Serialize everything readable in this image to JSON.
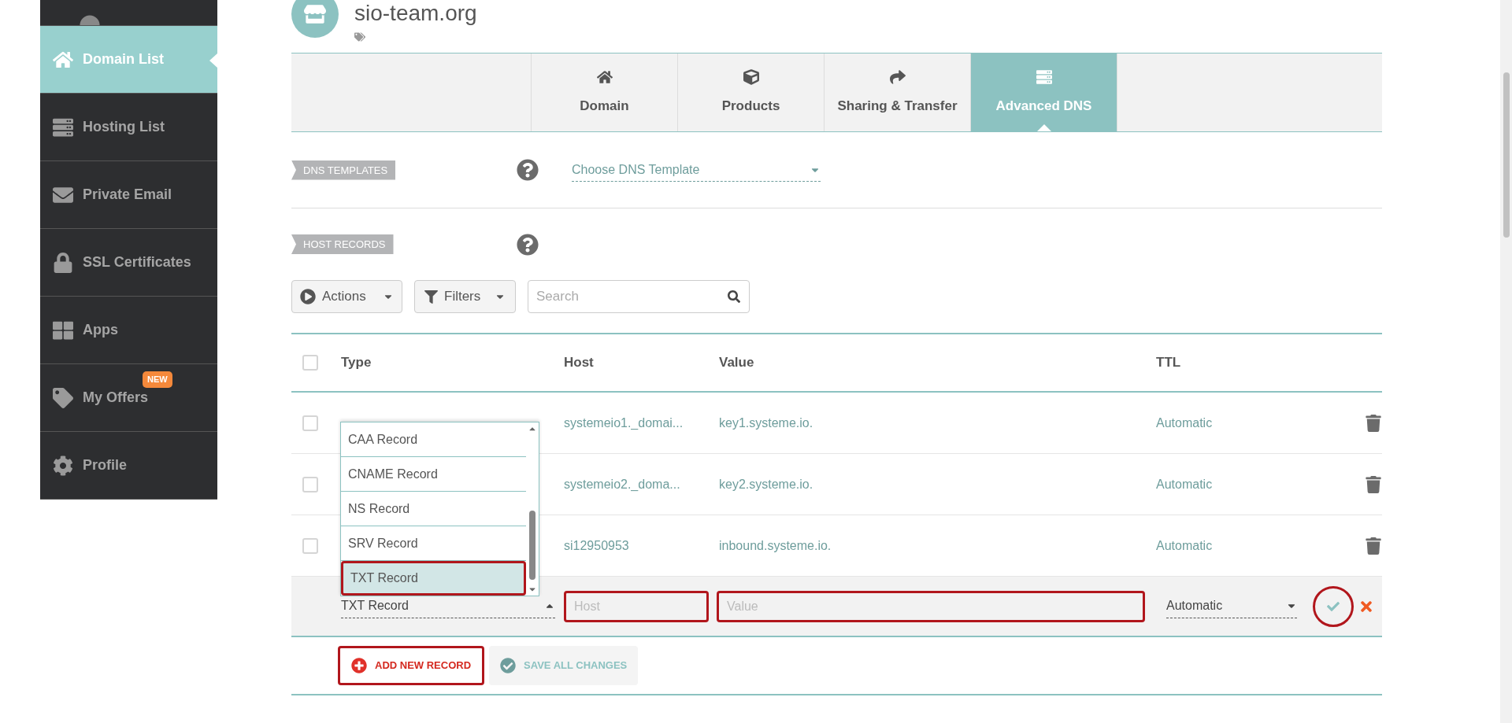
{
  "sidebar": {
    "items": [
      {
        "label": "Domain List",
        "selected": true
      },
      {
        "label": "Hosting List",
        "selected": false
      },
      {
        "label": "Private Email",
        "selected": false
      },
      {
        "label": "SSL Certificates",
        "selected": false
      },
      {
        "label": "Apps",
        "selected": false
      },
      {
        "label": "My Offers",
        "selected": false,
        "badge": "NEW"
      },
      {
        "label": "Profile",
        "selected": false
      }
    ]
  },
  "domain": {
    "title": "sio-team.org"
  },
  "tabs": [
    {
      "label": "Domain",
      "selected": false
    },
    {
      "label": "Products",
      "selected": false
    },
    {
      "label": "Sharing & Transfer",
      "selected": false
    },
    {
      "label": "Advanced DNS",
      "selected": true
    }
  ],
  "dns_templates": {
    "label": "DNS TEMPLATES",
    "select": {
      "placeholder": "Choose DNS Template"
    }
  },
  "host_records": {
    "label": "HOST RECORDS"
  },
  "toolbar": {
    "actions": "Actions",
    "filters": "Filters",
    "search": {
      "placeholder": "Search"
    }
  },
  "table": {
    "columns": [
      "Type",
      "Host",
      "Value",
      "TTL"
    ],
    "header_checked": false,
    "rows": [
      {
        "checked": false,
        "host": "systemeio1._domai...",
        "value": "key1.systeme.io.",
        "ttl": "Automatic"
      },
      {
        "checked": false,
        "host": "systemeio2._doma...",
        "value": "key2.systeme.io.",
        "ttl": "Automatic"
      },
      {
        "checked": false,
        "host": "si12950953",
        "value": "inbound.systeme.io.",
        "ttl": "Automatic"
      }
    ],
    "new_row": {
      "type": "TXT Record",
      "host": {
        "placeholder": "Host",
        "highlighted": true
      },
      "value": {
        "placeholder": "Value",
        "highlighted": true
      },
      "ttl": "Automatic",
      "confirm_highlighted": true
    }
  },
  "type_dropdown": {
    "options": [
      {
        "label": "CAA Record",
        "selected": false,
        "highlighted": false
      },
      {
        "label": "CNAME Record",
        "selected": false,
        "highlighted": false
      },
      {
        "label": "NS Record",
        "selected": false,
        "highlighted": false
      },
      {
        "label": "SRV Record",
        "selected": false,
        "highlighted": false
      },
      {
        "label": "TXT Record",
        "selected": true,
        "highlighted": true
      }
    ]
  },
  "footer_buttons": [
    {
      "label": "ADD NEW RECORD",
      "kind": "add",
      "highlighted": true
    },
    {
      "label": "SAVE ALL CHANGES",
      "kind": "save",
      "highlighted": false
    }
  ]
}
